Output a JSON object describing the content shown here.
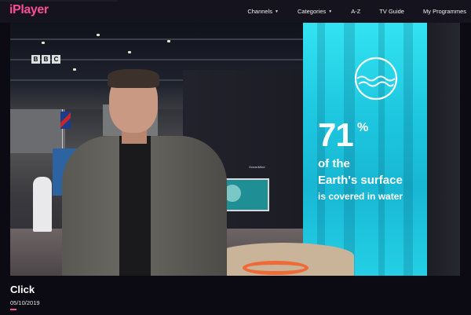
{
  "header": {
    "logo_text": "iPlayer",
    "accent_color": "#ff4c98",
    "nav": [
      {
        "label": "Channels",
        "has_dropdown": true
      },
      {
        "label": "Categories",
        "has_dropdown": true
      },
      {
        "label": "A-Z",
        "has_dropdown": false
      },
      {
        "label": "TV Guide",
        "has_dropdown": false
      },
      {
        "label": "My Programmes",
        "has_dropdown": false
      }
    ]
  },
  "player": {
    "watermark": [
      "B",
      "B",
      "C"
    ],
    "water_fact": {
      "percent": "71",
      "percent_sign": "%",
      "line1": "of the",
      "line2": "Earth's surface",
      "line3": "is covered in water"
    },
    "ocean_display_title": "OceanMind"
  },
  "programme": {
    "title": "Click",
    "date": "05/10/2019"
  },
  "colors": {
    "background": "#0c0a13",
    "topbar": "#15131d",
    "water": "#1ec8e0"
  }
}
